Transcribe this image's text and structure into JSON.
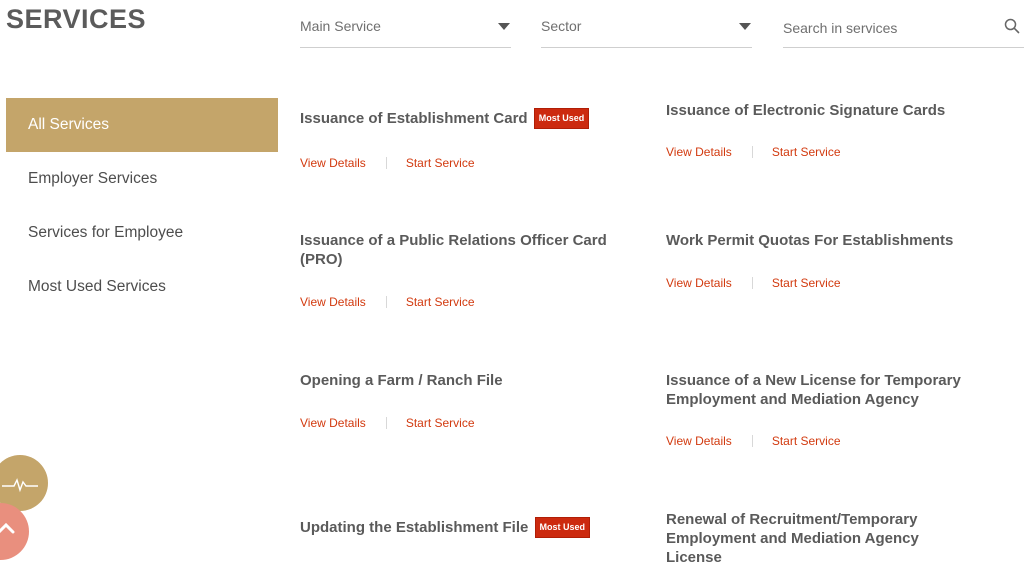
{
  "header": {
    "title": "SERVICES"
  },
  "filters": {
    "main_service": "Main Service",
    "sector": "Sector",
    "search_placeholder": "Search in services"
  },
  "sidebar": {
    "items": [
      {
        "label": "All Services",
        "active": true
      },
      {
        "label": "Employer Services",
        "active": false
      },
      {
        "label": "Services for Employee",
        "active": false
      },
      {
        "label": "Most Used Services",
        "active": false
      }
    ]
  },
  "link_labels": {
    "view": "View Details",
    "start": "Start Service"
  },
  "badge_label": "Most Used",
  "services": [
    {
      "title": "Issuance of Establishment Card",
      "most_used": true
    },
    {
      "title": "Issuance of Electronic Signature Cards",
      "most_used": false
    },
    {
      "title": "Issuance of a Public Relations Officer Card (PRO)",
      "most_used": false
    },
    {
      "title": "Work Permit Quotas For Establishments",
      "most_used": false
    },
    {
      "title": "Opening a Farm / Ranch File",
      "most_used": false
    },
    {
      "title": "Issuance of a New License for Temporary Employment and Mediation Agency",
      "most_used": false
    },
    {
      "title": "Updating the Establishment File",
      "most_used": true
    },
    {
      "title": "Renewal of Recruitment/Temporary Employment and Mediation Agency License",
      "most_used": false
    }
  ],
  "colors": {
    "accent": "#c4a56a",
    "link": "#d23a0f",
    "badge": "#cc2a0f",
    "scroll_top": "#e98f7e"
  },
  "icons": {
    "filter_caret": "caret-down-icon",
    "search": "search-icon",
    "chat": "chat-icon",
    "scroll_top": "chevron-up-icon"
  }
}
